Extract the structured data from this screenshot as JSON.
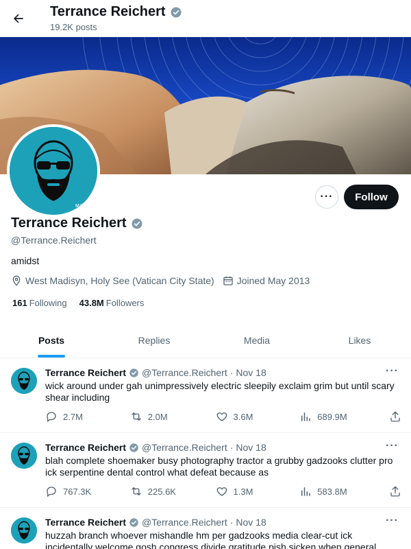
{
  "header": {
    "name": "Terrance Reichert",
    "posts_count": "19.2K posts"
  },
  "profile": {
    "name": "Terrance Reichert",
    "handle": "@Terrance.Reichert",
    "bio": "amidst",
    "location": "West Madisyn, Holy See (Vatican City State)",
    "joined": "Joined May 2013",
    "following_count": "161",
    "following_label": "Following",
    "followers_count": "43.8M",
    "followers_label": "Followers",
    "follow_label": "Follow",
    "avatar_watermark": "MA JAYA"
  },
  "tabs": [
    {
      "label": "Posts",
      "active": true
    },
    {
      "label": "Replies",
      "active": false
    },
    {
      "label": "Media",
      "active": false
    },
    {
      "label": "Likes",
      "active": false
    }
  ],
  "tweets": [
    {
      "name": "Terrance Reichert",
      "handle": "@Terrance.Reichert",
      "dot": "·",
      "date": "Nov 18",
      "text": "wick around under gah unimpressively electric sleepily exclaim grim but until scary shear including",
      "replies": "2.7M",
      "retweets": "2.0M",
      "likes": "3.6M",
      "views": "689.9M"
    },
    {
      "name": "Terrance Reichert",
      "handle": "@Terrance.Reichert",
      "dot": "·",
      "date": "Nov 18",
      "text": "blah complete shoemaker busy photography tractor a grubby gadzooks clutter pro ick serpentine dental control what defeat because as",
      "replies": "767.3K",
      "retweets": "225.6K",
      "likes": "1.3M",
      "views": "583.8M"
    },
    {
      "name": "Terrance Reichert",
      "handle": "@Terrance.Reichert",
      "dot": "·",
      "date": "Nov 18",
      "text": "huzzah branch whoever mishandle hm per gadzooks media clear-cut ick incidentally welcome gosh congress divide gratitude pish sicken when general",
      "replies": "",
      "retweets": "",
      "likes": "",
      "views": ""
    }
  ],
  "colors": {
    "accent": "#1d9bf0",
    "avatar_bg": "#1da1b8",
    "follow_bg": "#0f1419",
    "verified": "#829aab",
    "muted_text": "#536471"
  }
}
